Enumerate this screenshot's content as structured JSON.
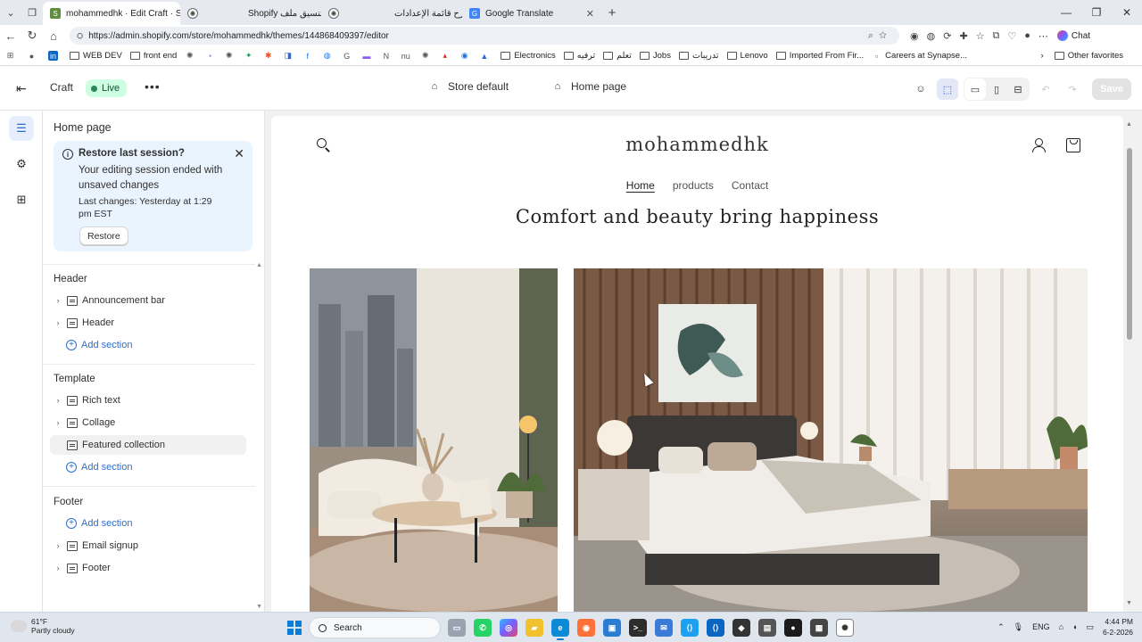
{
  "browser": {
    "tabs": [
      {
        "title": "mohammedhk · Edit Craft · Shopify",
        "active": true,
        "favicon_color": "#5e8e3e"
      },
      {
        "title": "Shopify تنسيق ملف",
        "active": false,
        "favicon_color": "#444444"
      },
      {
        "title": "شرح قائمة الإعدادات",
        "active": false,
        "favicon_color": "#444444"
      },
      {
        "title": "Google Translate",
        "active": false,
        "favicon_color": "#4285f4"
      }
    ],
    "url": "https://admin.shopify.com/store/mohammedhk/themes/144868409397/editor",
    "chat_label": "Chat",
    "bookmarks": [
      {
        "label": "",
        "icon": "github-icon"
      },
      {
        "label": "",
        "icon": "linkedin-icon"
      },
      {
        "label": "WEB DEV",
        "icon": "folder"
      },
      {
        "label": "front end",
        "icon": "folder"
      },
      {
        "label": "Electronics",
        "icon": "folder"
      },
      {
        "label": "ترفيه",
        "icon": "folder"
      },
      {
        "label": "تعلم",
        "icon": "folder"
      },
      {
        "label": "Jobs",
        "icon": "folder"
      },
      {
        "label": "تدريبات",
        "icon": "folder"
      },
      {
        "label": "Lenovo",
        "icon": "folder"
      },
      {
        "label": "Imported From Fir...",
        "icon": "folder"
      },
      {
        "label": "Careers at Synapse...",
        "icon": "synapse-icon"
      }
    ],
    "other_favorites": "Other favorites"
  },
  "topbar": {
    "theme_name": "Craft",
    "status": "Live",
    "store_selector": "Store default",
    "page_selector": "Home page",
    "save_label": "Save"
  },
  "sidebar": {
    "title": "Home page",
    "banner": {
      "title": "Restore last session?",
      "text": "Your editing session ended with unsaved changes",
      "meta": "Last changes: Yesterday at 1:29 pm EST",
      "button": "Restore"
    },
    "groups": [
      {
        "heading": "Header",
        "items": [
          {
            "label": "Announcement bar",
            "type": "section"
          },
          {
            "label": "Header",
            "type": "section"
          },
          {
            "label": "Add section",
            "type": "add"
          }
        ]
      },
      {
        "heading": "Template",
        "items": [
          {
            "label": "Rich text",
            "type": "section"
          },
          {
            "label": "Collage",
            "type": "section"
          },
          {
            "label": "Featured collection",
            "type": "section",
            "highlighted": true
          },
          {
            "label": "Add section",
            "type": "add"
          }
        ]
      },
      {
        "heading": "Footer",
        "items": [
          {
            "label": "Add section",
            "type": "add"
          },
          {
            "label": "Email signup",
            "type": "section"
          },
          {
            "label": "Footer",
            "type": "section"
          }
        ]
      }
    ]
  },
  "preview": {
    "logo": "mohammedhk",
    "nav": [
      "Home",
      "products",
      "Contact"
    ],
    "headline": "Comfort and beauty bring happiness"
  },
  "taskbar": {
    "weather_temp": "61°F",
    "weather_desc": "Partly cloudy",
    "search_label": "Search",
    "language": "ENG",
    "time": "4:44 PM",
    "date": "6-2-2026"
  }
}
